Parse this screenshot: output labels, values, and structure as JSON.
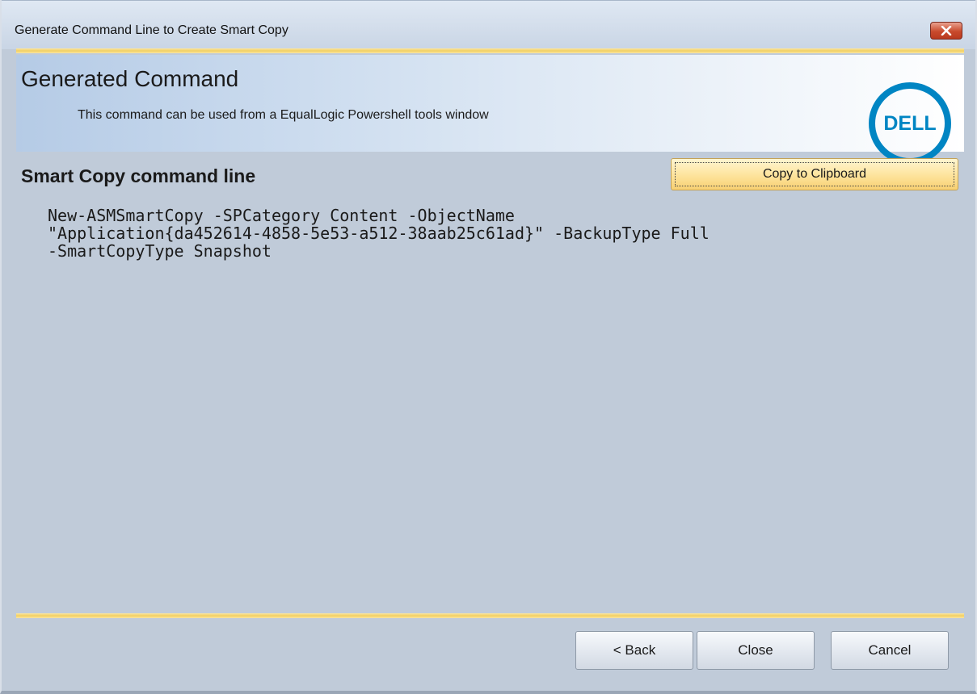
{
  "window": {
    "title": "Generate Command Line to Create Smart Copy",
    "close_icon": "close-x-icon"
  },
  "header": {
    "title": "Generated Command",
    "subtitle": "This command can be used from a EqualLogic Powershell tools window",
    "logo_text": "DELL",
    "logo_color": "#0085c3"
  },
  "section": {
    "title": "Smart Copy command line",
    "copy_button_label": "Copy to Clipboard"
  },
  "command": {
    "text": "New-ASMSmartCopy -SPCategory Content -ObjectName\n\"Application{da452614-4858-5e53-a512-38aab25c61ad}\" -BackupType Full\n-SmartCopyType Snapshot"
  },
  "footer": {
    "back_label": "< Back",
    "close_label": "Close",
    "cancel_label": "Cancel"
  },
  "colors": {
    "accent_gold": "#f1cf62",
    "close_button_red": "#c94a2d",
    "body_background": "#c0cbd9"
  }
}
